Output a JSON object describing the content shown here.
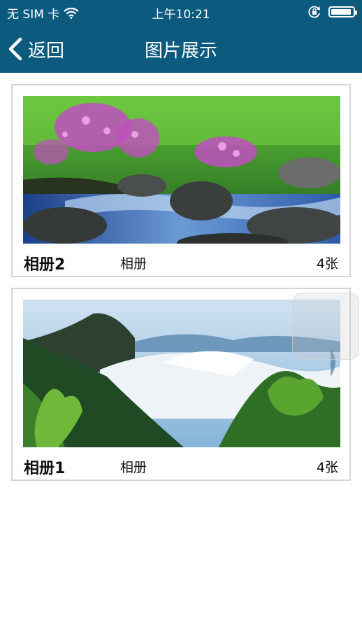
{
  "status_bar": {
    "carrier": "无 SIM 卡",
    "time": "上午10:21"
  },
  "nav": {
    "back_label": "返回",
    "title": "图片展示"
  },
  "albums": [
    {
      "name": "相册2",
      "type": "相册",
      "count": "4张",
      "image": "river-rocks-flowers"
    },
    {
      "name": "相册1",
      "type": "相册",
      "count": "4张",
      "image": "mountain-clouds"
    }
  ],
  "colors": {
    "nav_bg": "#0c5a7e",
    "card_border": "#d6d6d6"
  }
}
